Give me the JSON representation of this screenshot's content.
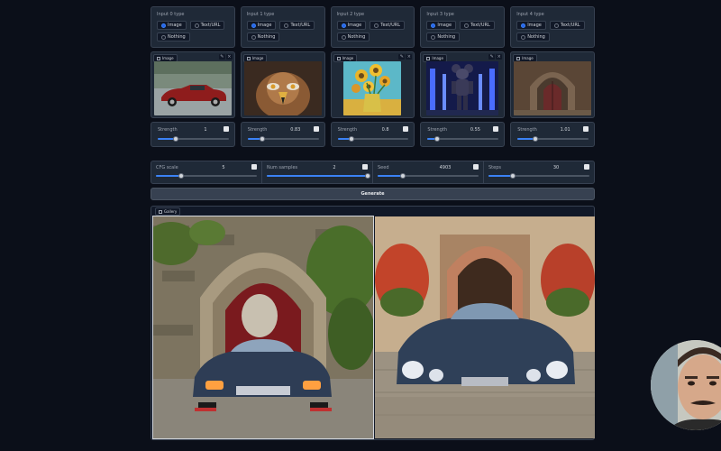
{
  "inputs": [
    {
      "type_label": "Input 0 type",
      "options": [
        "Image",
        "Text/URL",
        "Nothing"
      ],
      "selected": "Image",
      "image_tag": "Image",
      "strength_label": "Strength",
      "strength_value": "1",
      "strength_fraction": 0.25
    },
    {
      "type_label": "Input 1 type",
      "options": [
        "Image",
        "Text/URL",
        "Nothing"
      ],
      "selected": "Image",
      "image_tag": "Image",
      "strength_label": "Strength",
      "strength_value": "0.83",
      "strength_fraction": 0.2
    },
    {
      "type_label": "Input 2 type",
      "options": [
        "Image",
        "Text/URL",
        "Nothing"
      ],
      "selected": "Image",
      "image_tag": "Image",
      "strength_label": "Strength",
      "strength_value": "0.8",
      "strength_fraction": 0.2
    },
    {
      "type_label": "Input 3 type",
      "options": [
        "Image",
        "Text/URL",
        "Nothing"
      ],
      "selected": "Image",
      "image_tag": "Image",
      "strength_label": "Strength",
      "strength_value": "0.55",
      "strength_fraction": 0.14
    },
    {
      "type_label": "Input 4 type",
      "options": [
        "Image",
        "Text/URL",
        "Nothing"
      ],
      "selected": "Image",
      "image_tag": "Image",
      "strength_label": "Strength",
      "strength_value": "1.01",
      "strength_fraction": 0.25
    }
  ],
  "params": [
    {
      "label": "CFG scale",
      "value": "5",
      "fraction": 0.25
    },
    {
      "label": "Num samples",
      "value": "2",
      "fraction": 1.0
    },
    {
      "label": "Seed",
      "value": "4903",
      "fraction": 0.25
    },
    {
      "label": "Steps",
      "value": "30",
      "fraction": 0.24
    }
  ],
  "generate_label": "Generate",
  "gallery_label": "Gallery",
  "colors": {
    "background": "#0b0f19",
    "panel": "#1f2937",
    "accent": "#3b82f6"
  }
}
